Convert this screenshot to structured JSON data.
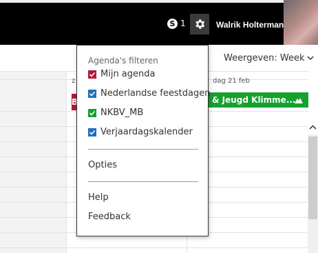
{
  "header": {
    "skype_glyph": "S",
    "skype_count": "1",
    "icons": {
      "skype": "skype-icon",
      "settings": "gear-icon"
    },
    "user_name": "Walrik Holtermans"
  },
  "toolbar": {
    "view_label": "Weergeven: Week",
    "view_icon": "chevron-down-icon"
  },
  "calendar": {
    "day_header_left": "z",
    "day_header_right": "dag 21 feb",
    "event_left_text": "B",
    "event_right_text": "& Jeugd Klimme...",
    "event_icon": "mountain-icon",
    "colors": {
      "green": "#16a02f",
      "red": "#b5173b",
      "blue": "#1f6fbf"
    }
  },
  "menu": {
    "heading": "Agenda's filteren",
    "calendars": [
      {
        "label": "Mijn agenda",
        "checked": true,
        "color": "#b5173b"
      },
      {
        "label": "Nederlandse feestdagen",
        "checked": true,
        "color": "#1f6fbf"
      },
      {
        "label": "NKBV_MB",
        "checked": true,
        "color": "#16a02f"
      },
      {
        "label": "Verjaardagskalender",
        "checked": true,
        "color": "#1f6fbf"
      }
    ],
    "options_label": "Opties",
    "help_label": "Help",
    "feedback_label": "Feedback"
  }
}
